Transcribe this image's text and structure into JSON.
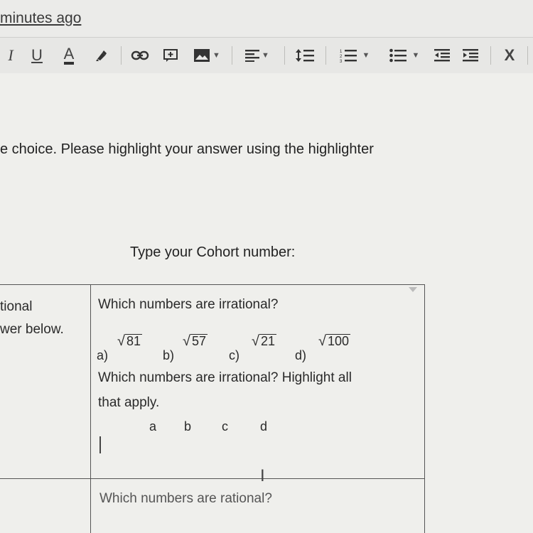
{
  "status": {
    "last_edit": "minutes ago"
  },
  "toolbar": {
    "italic": "I",
    "underline": "U",
    "text_color": "A",
    "remove_format": "X"
  },
  "document": {
    "instructions": "e choice. Please highlight your answer using the highlighter",
    "cohort_prompt": "Type your Cohort number:",
    "table": {
      "left_cell_line1": "tional",
      "left_cell_line2": "wer below.",
      "question1": "Which numbers are irrational?",
      "options": [
        {
          "label": "a)",
          "radicand": "81"
        },
        {
          "label": "b)",
          "radicand": "57"
        },
        {
          "label": "c)",
          "radicand": "21"
        },
        {
          "label": "d)",
          "radicand": "100"
        }
      ],
      "instruction_line1": "Which numbers are irrational? Highlight all",
      "instruction_line2": "that apply.",
      "answer_letters": [
        "a",
        "b",
        "c",
        "d"
      ],
      "question2": "Which numbers are rational?"
    }
  },
  "colors": {
    "background": "#ebebe9",
    "toolbar": "#e7e7e5",
    "text": "#2a2a2a",
    "table_border": "#555555"
  }
}
